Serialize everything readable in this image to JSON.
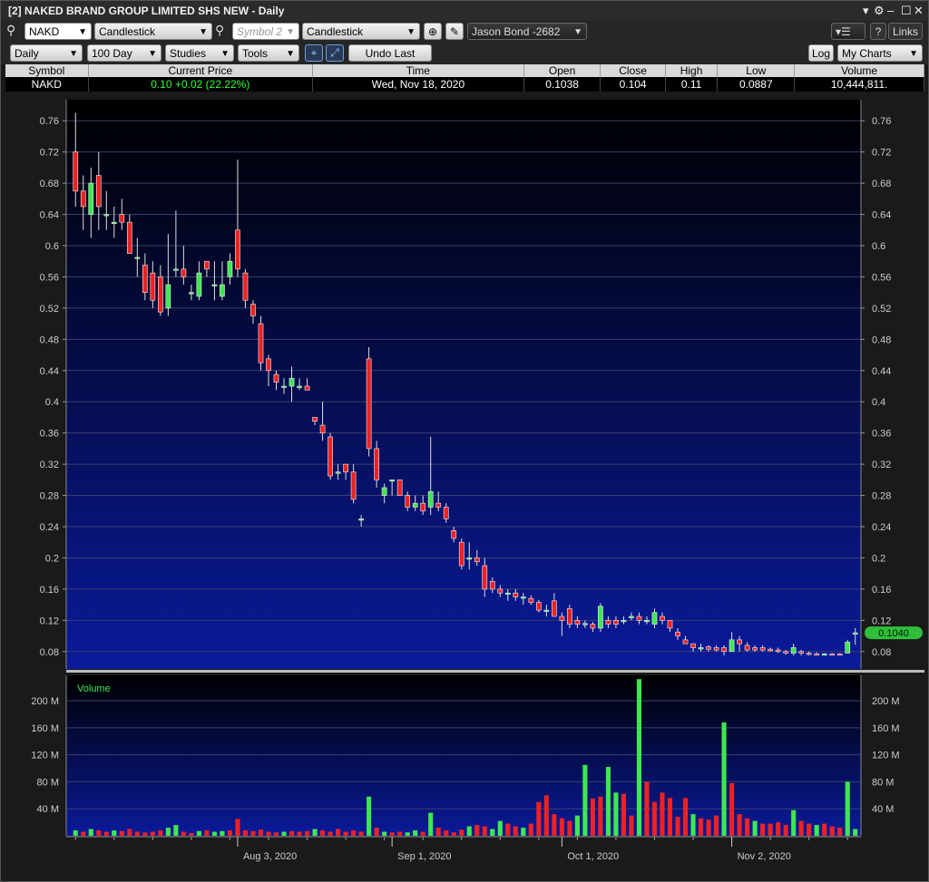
{
  "window": {
    "title": "[2] NAKED BRAND GROUP LIMITED SHS NEW - Daily"
  },
  "toolbar1": {
    "symbol": "NAKD",
    "chart_type_1": "Candlestick",
    "symbol2_placeholder": "Symbol 2",
    "chart_type_2": "Candlestick",
    "account": "Jason Bond -2682",
    "help_label": "?",
    "links_label": "Links"
  },
  "toolbar2": {
    "period": "Daily",
    "range": "100 Day",
    "studies": "Studies",
    "tools": "Tools",
    "undo_label": "Undo Last",
    "log_label": "Log",
    "mycharts": "My Charts"
  },
  "quote": {
    "headers": [
      "Symbol",
      "Current Price",
      "Time",
      "Open",
      "Close",
      "High",
      "Low",
      "Volume"
    ],
    "symbol": "NAKD",
    "current_price": "0.10",
    "change": "+0.02 (22.22%)",
    "time": "Wed, Nov 18, 2020",
    "open": "0.1038",
    "close": "0.104",
    "high": "0.11",
    "low": "0.0887",
    "volume": "10,444,811."
  },
  "chart_data": [
    {
      "type": "candlestick",
      "ylim": [
        0.06,
        0.78
      ],
      "yticks": [
        0.08,
        0.12,
        0.16,
        0.2,
        0.24,
        0.28,
        0.32,
        0.36,
        0.4,
        0.44,
        0.48,
        0.52,
        0.56,
        0.6,
        0.64,
        0.68,
        0.72,
        0.76
      ],
      "ytick_labels": [
        "0.08",
        "0.12",
        "0.16",
        "0.2",
        "0.24",
        "0.28",
        "0.32",
        "0.36",
        "0.4",
        "0.44",
        "0.48",
        "0.52",
        "0.56",
        "0.6",
        "0.64",
        "0.68",
        "0.72",
        "0.76"
      ],
      "last_price_label": "0.1040",
      "last_price": 0.104,
      "xtick_labels": [
        {
          "label": "Aug 3, 2020",
          "index": 21
        },
        {
          "label": "Sep 1, 2020",
          "index": 41
        },
        {
          "label": "Oct 1, 2020",
          "index": 63
        },
        {
          "label": "Nov 2, 2020",
          "index": 85
        }
      ],
      "candles": [
        [
          0.72,
          0.67,
          0.77,
          0.65
        ],
        [
          0.67,
          0.65,
          0.69,
          0.62
        ],
        [
          0.64,
          0.68,
          0.7,
          0.61
        ],
        [
          0.69,
          0.65,
          0.72,
          0.62
        ],
        [
          0.64,
          0.64,
          0.67,
          0.62
        ],
        [
          0.63,
          0.63,
          0.65,
          0.61
        ],
        [
          0.64,
          0.63,
          0.66,
          0.62
        ],
        [
          0.63,
          0.59,
          0.64,
          0.59
        ],
        [
          0.585,
          0.585,
          0.61,
          0.56
        ],
        [
          0.575,
          0.54,
          0.59,
          0.53
        ],
        [
          0.565,
          0.53,
          0.58,
          0.52
        ],
        [
          0.56,
          0.515,
          0.575,
          0.51
        ],
        [
          0.52,
          0.55,
          0.615,
          0.51
        ],
        [
          0.57,
          0.57,
          0.645,
          0.56
        ],
        [
          0.57,
          0.56,
          0.6,
          0.55
        ],
        [
          0.54,
          0.54,
          0.55,
          0.53
        ],
        [
          0.535,
          0.565,
          0.58,
          0.53
        ],
        [
          0.58,
          0.57,
          0.58,
          0.56
        ],
        [
          0.55,
          0.55,
          0.58,
          0.53
        ],
        [
          0.535,
          0.55,
          0.58,
          0.53
        ],
        [
          0.56,
          0.58,
          0.59,
          0.55
        ],
        [
          0.62,
          0.57,
          0.71,
          0.56
        ],
        [
          0.565,
          0.53,
          0.57,
          0.52
        ],
        [
          0.525,
          0.51,
          0.53,
          0.5
        ],
        [
          0.5,
          0.45,
          0.51,
          0.44
        ],
        [
          0.455,
          0.44,
          0.46,
          0.42
        ],
        [
          0.435,
          0.425,
          0.44,
          0.415
        ],
        [
          0.42,
          0.42,
          0.43,
          0.41
        ],
        [
          0.42,
          0.43,
          0.445,
          0.4
        ],
        [
          0.42,
          0.42,
          0.43,
          0.415
        ],
        [
          0.42,
          0.415,
          0.43,
          0.415
        ],
        [
          0.38,
          0.375,
          0.38,
          0.37
        ],
        [
          0.37,
          0.36,
          0.4,
          0.35
        ],
        [
          0.355,
          0.305,
          0.36,
          0.3
        ],
        [
          0.31,
          0.31,
          0.32,
          0.3
        ],
        [
          0.32,
          0.31,
          0.32,
          0.3
        ],
        [
          0.31,
          0.275,
          0.32,
          0.27
        ],
        [
          0.25,
          0.25,
          0.255,
          0.24
        ],
        [
          0.455,
          0.34,
          0.47,
          0.33
        ],
        [
          0.34,
          0.3,
          0.35,
          0.29
        ],
        [
          0.28,
          0.29,
          0.295,
          0.27
        ],
        [
          0.3,
          0.3,
          0.3,
          0.28
        ],
        [
          0.3,
          0.28,
          0.3,
          0.28
        ],
        [
          0.28,
          0.265,
          0.285,
          0.26
        ],
        [
          0.265,
          0.27,
          0.28,
          0.26
        ],
        [
          0.27,
          0.26,
          0.28,
          0.255
        ],
        [
          0.265,
          0.285,
          0.355,
          0.255
        ],
        [
          0.27,
          0.265,
          0.285,
          0.26
        ],
        [
          0.265,
          0.25,
          0.27,
          0.245
        ],
        [
          0.235,
          0.225,
          0.24,
          0.22
        ],
        [
          0.22,
          0.19,
          0.225,
          0.185
        ],
        [
          0.2,
          0.2,
          0.22,
          0.185
        ],
        [
          0.2,
          0.195,
          0.21,
          0.19
        ],
        [
          0.19,
          0.16,
          0.2,
          0.15
        ],
        [
          0.17,
          0.16,
          0.175,
          0.155
        ],
        [
          0.16,
          0.155,
          0.165,
          0.15
        ],
        [
          0.155,
          0.155,
          0.16,
          0.145
        ],
        [
          0.155,
          0.15,
          0.16,
          0.145
        ],
        [
          0.15,
          0.15,
          0.155,
          0.14
        ],
        [
          0.148,
          0.143,
          0.152,
          0.14
        ],
        [
          0.143,
          0.133,
          0.146,
          0.13
        ],
        [
          0.133,
          0.133,
          0.14,
          0.125
        ],
        [
          0.145,
          0.125,
          0.155,
          0.125
        ],
        [
          0.125,
          0.12,
          0.13,
          0.1
        ],
        [
          0.135,
          0.115,
          0.14,
          0.11
        ],
        [
          0.12,
          0.115,
          0.125,
          0.11
        ],
        [
          0.116,
          0.116,
          0.12,
          0.11
        ],
        [
          0.115,
          0.11,
          0.118,
          0.105
        ],
        [
          0.11,
          0.138,
          0.142,
          0.105
        ],
        [
          0.12,
          0.115,
          0.125,
          0.11
        ],
        [
          0.12,
          0.115,
          0.125,
          0.11
        ],
        [
          0.12,
          0.12,
          0.125,
          0.115
        ],
        [
          0.125,
          0.125,
          0.13,
          0.12
        ],
        [
          0.125,
          0.12,
          0.13,
          0.115
        ],
        [
          0.12,
          0.12,
          0.125,
          0.115
        ],
        [
          0.115,
          0.13,
          0.135,
          0.11
        ],
        [
          0.125,
          0.12,
          0.13,
          0.115
        ],
        [
          0.12,
          0.11,
          0.12,
          0.105
        ],
        [
          0.105,
          0.1,
          0.11,
          0.095
        ],
        [
          0.095,
          0.09,
          0.1,
          0.09
        ],
        [
          0.09,
          0.085,
          0.09,
          0.08
        ],
        [
          0.085,
          0.085,
          0.09,
          0.08
        ],
        [
          0.086,
          0.083,
          0.088,
          0.08
        ],
        [
          0.085,
          0.082,
          0.088,
          0.08
        ],
        [
          0.085,
          0.08,
          0.088,
          0.075
        ],
        [
          0.08,
          0.095,
          0.105,
          0.08
        ],
        [
          0.095,
          0.09,
          0.1,
          0.08
        ],
        [
          0.088,
          0.082,
          0.092,
          0.08
        ],
        [
          0.085,
          0.082,
          0.088,
          0.08
        ],
        [
          0.085,
          0.082,
          0.088,
          0.08
        ],
        [
          0.083,
          0.081,
          0.085,
          0.08
        ],
        [
          0.082,
          0.08,
          0.085,
          0.078
        ],
        [
          0.08,
          0.078,
          0.082,
          0.076
        ],
        [
          0.078,
          0.085,
          0.09,
          0.075
        ],
        [
          0.08,
          0.078,
          0.082,
          0.075
        ],
        [
          0.078,
          0.077,
          0.08,
          0.075
        ],
        [
          0.077,
          0.076,
          0.079,
          0.075
        ],
        [
          0.076,
          0.077,
          0.078,
          0.075
        ],
        [
          0.077,
          0.076,
          0.078,
          0.075
        ],
        [
          0.077,
          0.076,
          0.078,
          0.075
        ],
        [
          0.078,
          0.092,
          0.095,
          0.078
        ],
        [
          0.1038,
          0.104,
          0.11,
          0.0887
        ]
      ]
    },
    {
      "type": "bar",
      "title": "Volume",
      "ylim": [
        0,
        235
      ],
      "yticks": [
        40,
        80,
        120,
        160,
        200
      ],
      "ytick_labels": [
        "40 M",
        "80 M",
        "120 M",
        "160 M",
        "200 M"
      ],
      "unit": "M",
      "values": [
        [
          8,
          "g"
        ],
        [
          6,
          "r"
        ],
        [
          10,
          "g"
        ],
        [
          8,
          "r"
        ],
        [
          6,
          "r"
        ],
        [
          8,
          "g"
        ],
        [
          7,
          "r"
        ],
        [
          10,
          "r"
        ],
        [
          6,
          "r"
        ],
        [
          5,
          "r"
        ],
        [
          6,
          "r"
        ],
        [
          8,
          "r"
        ],
        [
          12,
          "g"
        ],
        [
          16,
          "g"
        ],
        [
          6,
          "r"
        ],
        [
          4,
          "r"
        ],
        [
          7,
          "g"
        ],
        [
          8,
          "r"
        ],
        [
          6,
          "g"
        ],
        [
          7,
          "g"
        ],
        [
          8,
          "r"
        ],
        [
          25,
          "r"
        ],
        [
          8,
          "r"
        ],
        [
          7,
          "r"
        ],
        [
          9,
          "r"
        ],
        [
          6,
          "r"
        ],
        [
          5,
          "r"
        ],
        [
          6,
          "g"
        ],
        [
          7,
          "r"
        ],
        [
          6,
          "r"
        ],
        [
          7,
          "r"
        ],
        [
          10,
          "g"
        ],
        [
          8,
          "r"
        ],
        [
          6,
          "r"
        ],
        [
          10,
          "r"
        ],
        [
          6,
          "r"
        ],
        [
          8,
          "r"
        ],
        [
          6,
          "r"
        ],
        [
          58,
          "g"
        ],
        [
          12,
          "r"
        ],
        [
          6,
          "g"
        ],
        [
          5,
          "r"
        ],
        [
          6,
          "r"
        ],
        [
          5,
          "g"
        ],
        [
          8,
          "g"
        ],
        [
          6,
          "r"
        ],
        [
          34,
          "g"
        ],
        [
          12,
          "r"
        ],
        [
          8,
          "r"
        ],
        [
          5,
          "r"
        ],
        [
          9,
          "r"
        ],
        [
          14,
          "g"
        ],
        [
          16,
          "r"
        ],
        [
          14,
          "r"
        ],
        [
          10,
          "g"
        ],
        [
          22,
          "g"
        ],
        [
          18,
          "r"
        ],
        [
          14,
          "r"
        ],
        [
          12,
          "g"
        ],
        [
          18,
          "r"
        ],
        [
          50,
          "r"
        ],
        [
          60,
          "r"
        ],
        [
          32,
          "r"
        ],
        [
          26,
          "r"
        ],
        [
          22,
          "r"
        ],
        [
          30,
          "g"
        ],
        [
          105,
          "g"
        ],
        [
          55,
          "r"
        ],
        [
          58,
          "r"
        ],
        [
          102,
          "g"
        ],
        [
          64,
          "g"
        ],
        [
          62,
          "r"
        ],
        [
          30,
          "r"
        ],
        [
          232,
          "g"
        ],
        [
          80,
          "r"
        ],
        [
          50,
          "r"
        ],
        [
          64,
          "r"
        ],
        [
          56,
          "r"
        ],
        [
          28,
          "r"
        ],
        [
          56,
          "r"
        ],
        [
          32,
          "g"
        ],
        [
          26,
          "r"
        ],
        [
          24,
          "r"
        ],
        [
          30,
          "r"
        ],
        [
          168,
          "g"
        ],
        [
          78,
          "r"
        ],
        [
          32,
          "r"
        ],
        [
          26,
          "r"
        ],
        [
          22,
          "g"
        ],
        [
          18,
          "r"
        ],
        [
          18,
          "r"
        ],
        [
          20,
          "r"
        ],
        [
          16,
          "r"
        ],
        [
          38,
          "g"
        ],
        [
          22,
          "r"
        ],
        [
          18,
          "r"
        ],
        [
          16,
          "g"
        ],
        [
          18,
          "r"
        ],
        [
          14,
          "r"
        ],
        [
          12,
          "r"
        ],
        [
          80,
          "g"
        ],
        [
          10,
          "g"
        ]
      ]
    }
  ]
}
